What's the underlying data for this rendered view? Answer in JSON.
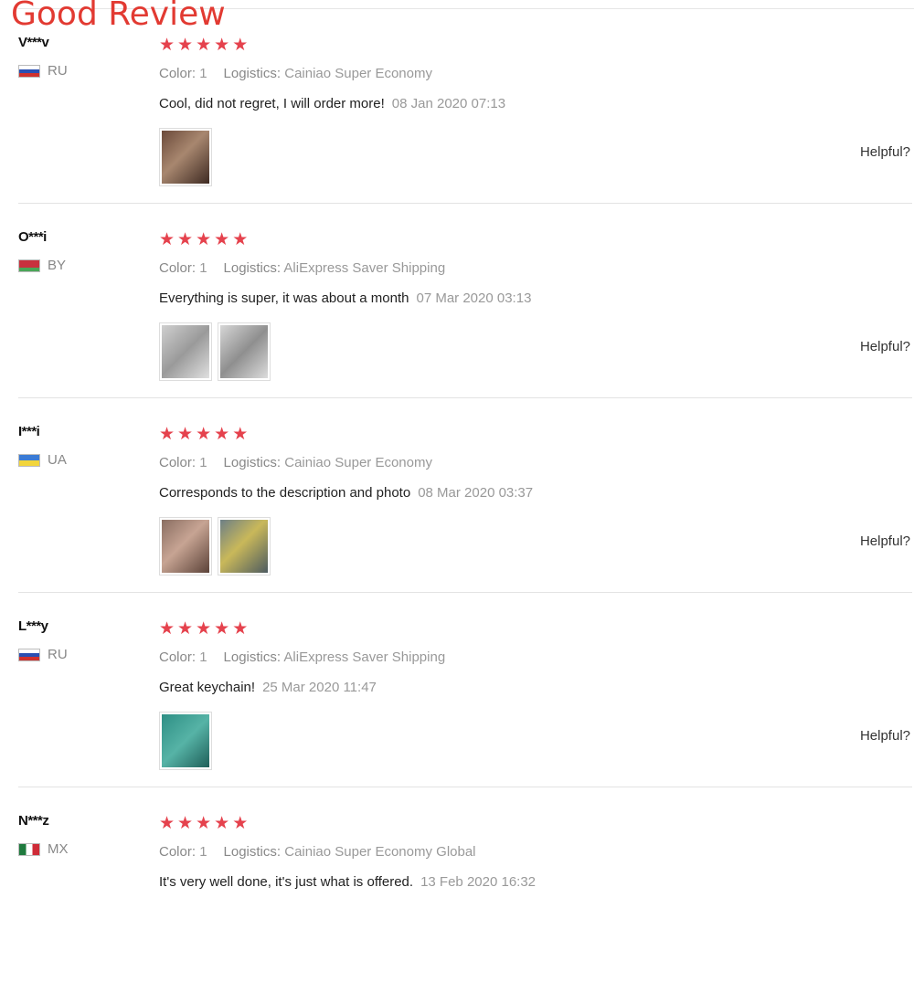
{
  "title": "Good Review",
  "colors": {
    "star": "#e5424d",
    "title": "#e23a32"
  },
  "reviews": [
    {
      "user": "V***v",
      "country": "RU",
      "flag": "russia-flag",
      "stars": 5,
      "color_label": "Color:",
      "color_value": "1",
      "logistics_label": "Logistics:",
      "logistics_value": "Cainiao Super Economy",
      "text": "Cool, did not regret, I will order more!",
      "date": "08 Jan 2020 07:13",
      "photos": 1,
      "helpful": "Helpful?"
    },
    {
      "user": "O***i",
      "country": "BY",
      "flag": "belarus-flag",
      "stars": 5,
      "color_label": "Color:",
      "color_value": "1",
      "logistics_label": "Logistics:",
      "logistics_value": "AliExpress Saver Shipping",
      "text": "Everything is super, it was about a month",
      "date": "07 Mar 2020 03:13",
      "photos": 2,
      "helpful": "Helpful?"
    },
    {
      "user": "I***i",
      "country": "UA",
      "flag": "ukraine-flag",
      "stars": 5,
      "color_label": "Color:",
      "color_value": "1",
      "logistics_label": "Logistics:",
      "logistics_value": "Cainiao Super Economy",
      "text": "Corresponds to the description and photo",
      "date": "08 Mar 2020 03:37",
      "photos": 2,
      "helpful": "Helpful?"
    },
    {
      "user": "L***y",
      "country": "RU",
      "flag": "russia-flag",
      "stars": 5,
      "color_label": "Color:",
      "color_value": "1",
      "logistics_label": "Logistics:",
      "logistics_value": "AliExpress Saver Shipping",
      "text": "Great keychain!",
      "date": "25 Mar 2020 11:47",
      "photos": 1,
      "helpful": "Helpful?"
    },
    {
      "user": "N***z",
      "country": "MX",
      "flag": "mexico-flag",
      "stars": 5,
      "color_label": "Color:",
      "color_value": "1",
      "logistics_label": "Logistics:",
      "logistics_value": "Cainiao Super Economy Global",
      "text": "It's very well done, it's just what is offered.",
      "date": "13 Feb 2020 16:32",
      "photos": 0,
      "helpful": ""
    }
  ]
}
